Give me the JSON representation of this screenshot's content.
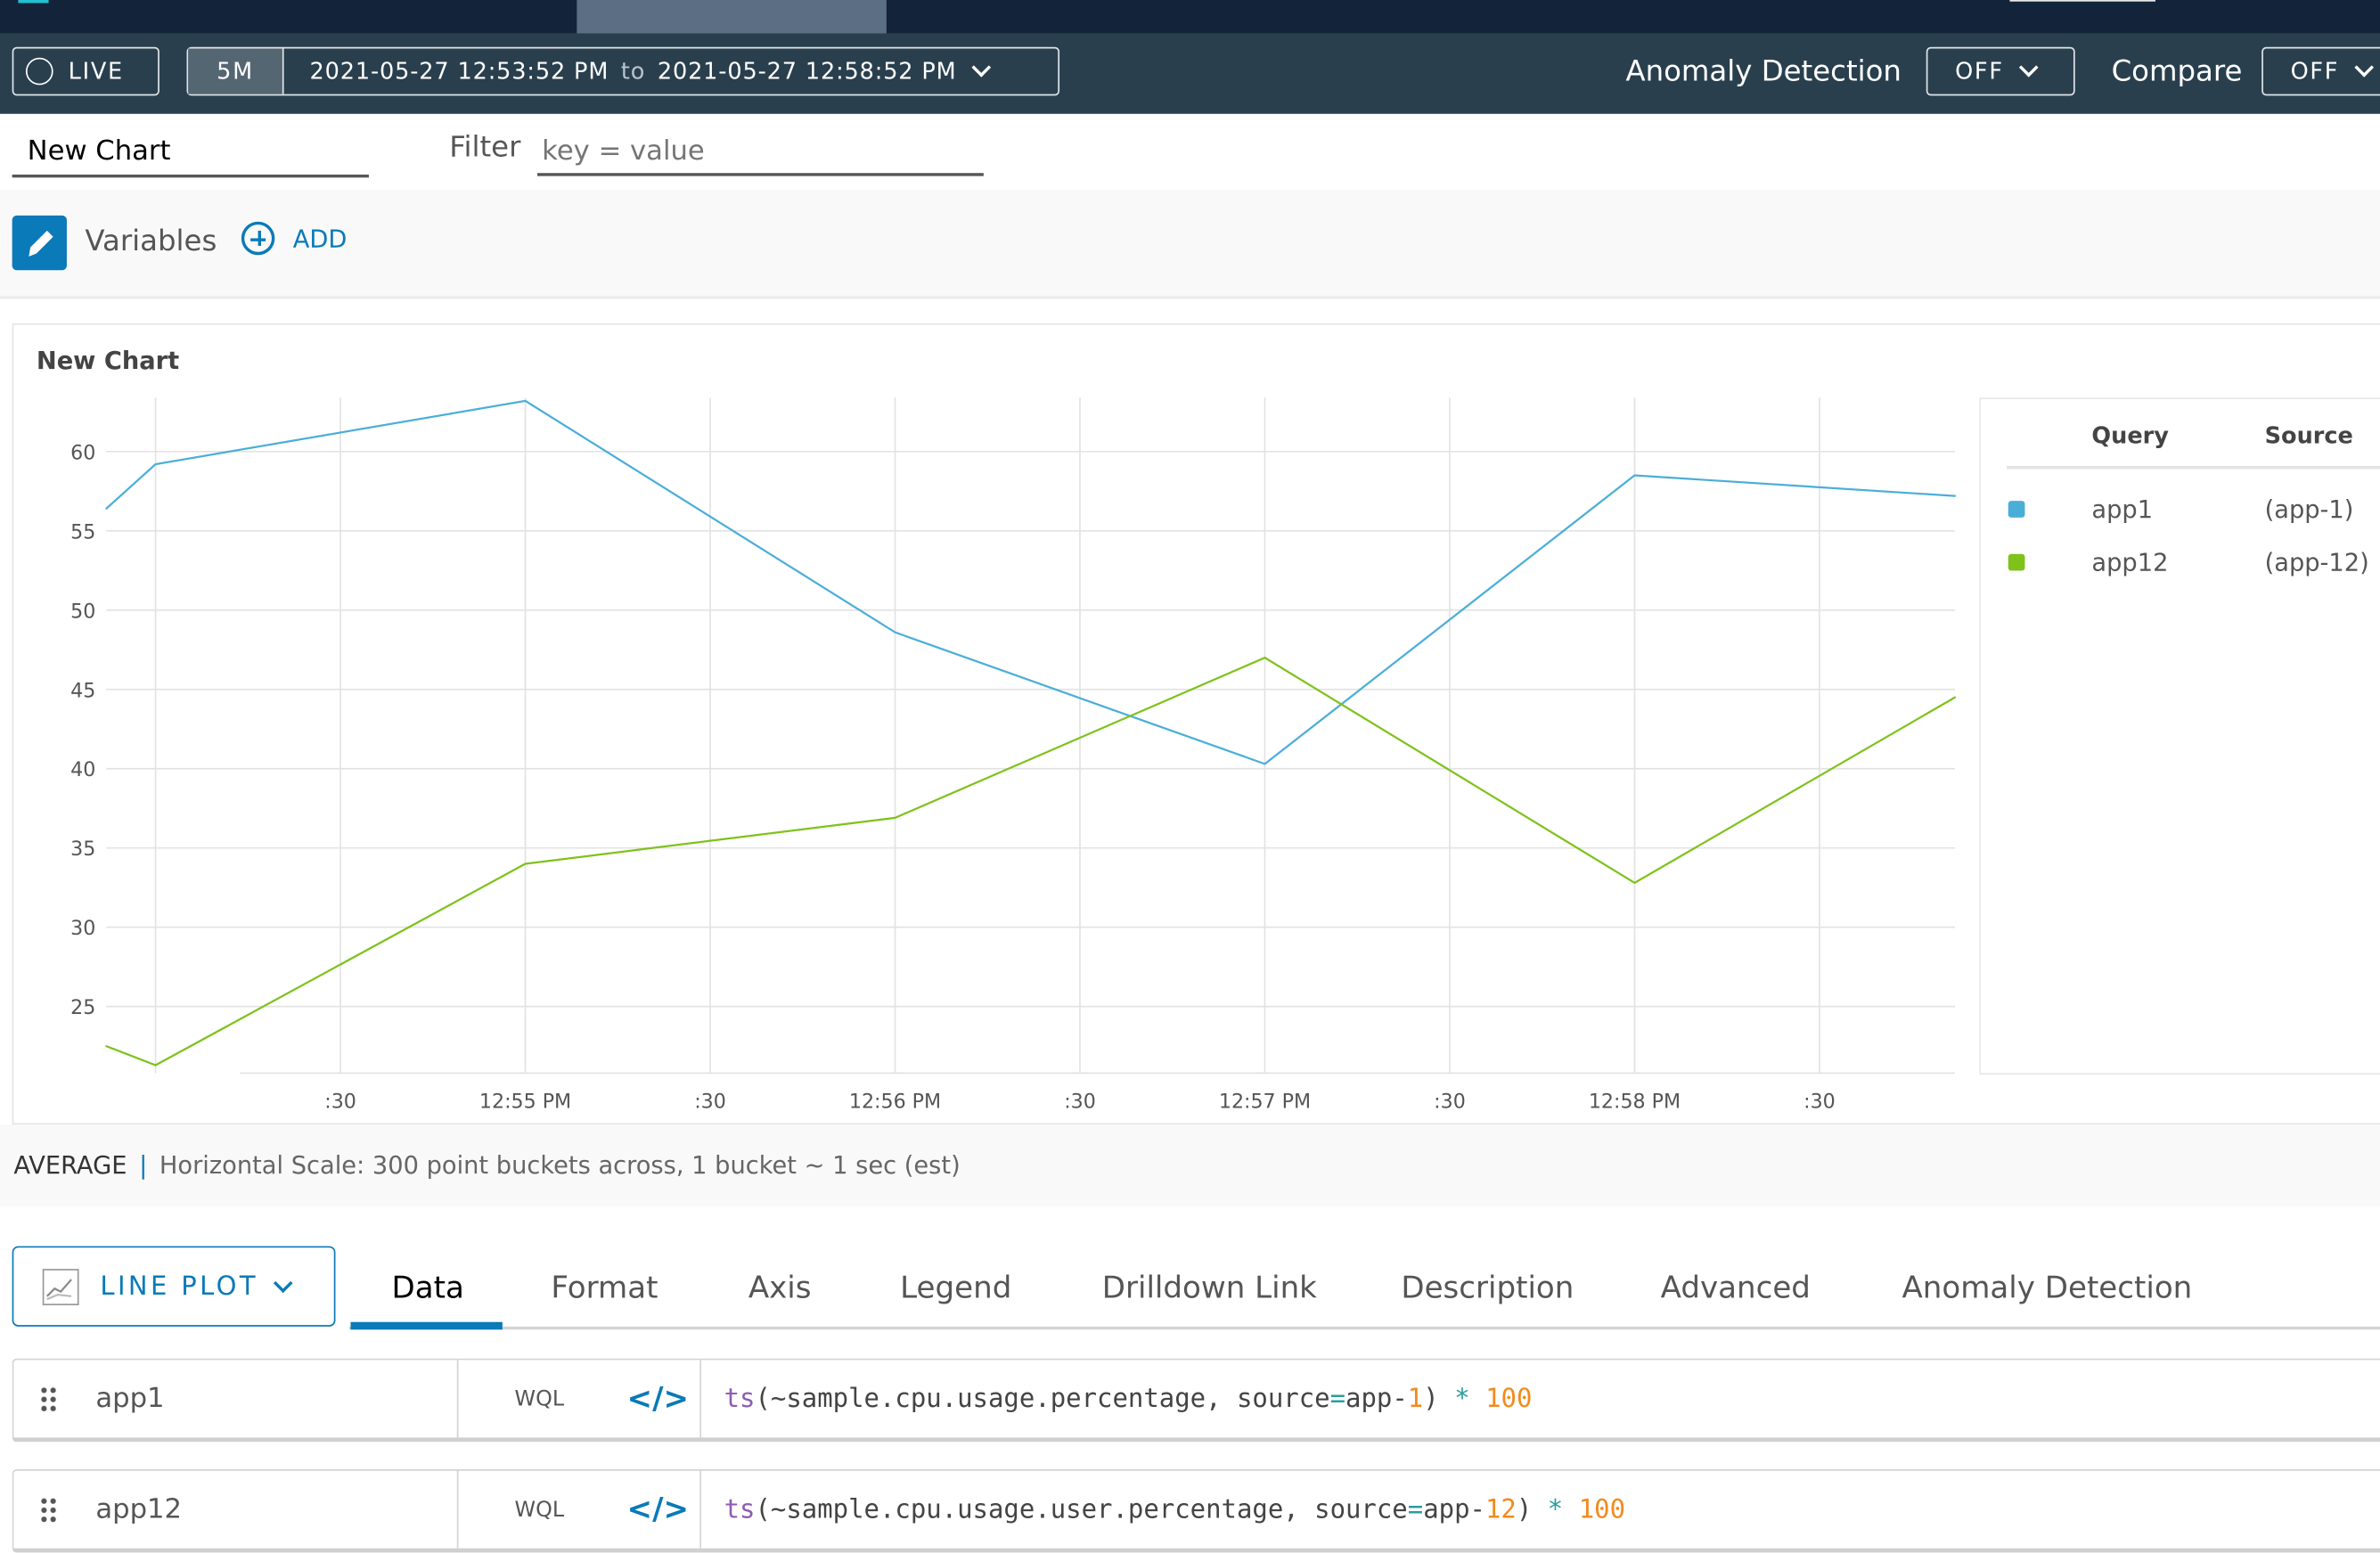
{
  "toolbar": {
    "live_label": "LIVE",
    "range_preset": "5M",
    "range_start": "2021-05-27 12:53:52 PM",
    "range_to": "to",
    "range_end": "2021-05-27 12:58:52 PM",
    "anomaly_label": "Anomaly Detection",
    "anomaly_value": "OFF",
    "compare_label": "Compare",
    "compare_value": "OFF"
  },
  "editor": {
    "chart_name": "New Chart",
    "filter_label": "Filter",
    "filter_placeholder": "key = value",
    "variables_label": "Variables",
    "add_label": "ADD"
  },
  "chart": {
    "title": "New Chart",
    "legend": {
      "headers": [
        "Query",
        "Source"
      ],
      "items": [
        {
          "query": "app1",
          "source": "(app-1)",
          "color": "#4aaed9"
        },
        {
          "query": "app12",
          "source": "(app-12)",
          "color": "#7ec21b"
        }
      ]
    }
  },
  "footer": {
    "mode": "AVERAGE",
    "scale_text": "Horizontal Scale: 300 point buckets across, 1 bucket ~ 1 sec (est)"
  },
  "chart_type_label": "LINE PLOT",
  "tabs": [
    "Data",
    "Format",
    "Axis",
    "Legend",
    "Drilldown Link",
    "Description",
    "Advanced",
    "Anomaly Detection"
  ],
  "active_tab": "Data",
  "queries": [
    {
      "name": "app1",
      "lang": "WQL",
      "fn": "ts",
      "metric": "(~sample.cpu.usage.percentage, source",
      "eq": "=",
      "src": "app-",
      "srcnum": "1",
      "close": ")",
      "op": "*",
      "mult": "100"
    },
    {
      "name": "app12",
      "lang": "WQL",
      "fn": "ts",
      "metric": "(~sample.cpu.usage.user.percentage, source",
      "eq": "=",
      "src": "app-",
      "srcnum": "12",
      "close": ")",
      "op": "*",
      "mult": "100"
    }
  ],
  "colors": {
    "accent": "#0a7ab8",
    "toolbar_bg": "#2a3f4e",
    "nav_bg": "#13243a"
  },
  "chart_data": {
    "type": "line",
    "title": "New Chart",
    "x": [
      "12:53:52",
      "12:54:00",
      "12:55:00",
      "12:56:00",
      "12:57:00",
      "12:58:00",
      "12:58:52"
    ],
    "series": [
      {
        "name": "app1",
        "color": "#4aaed9",
        "values": [
          56.4,
          59.2,
          63.2,
          48.6,
          40.3,
          58.5,
          57.2
        ]
      },
      {
        "name": "app12",
        "color": "#7ec21b",
        "values": [
          22.5,
          21.3,
          34.0,
          36.9,
          47.0,
          32.8,
          44.5
        ]
      }
    ],
    "xlim": [
      "12:53:52",
      "12:58:52"
    ],
    "ylim": [
      20.8,
      63.4
    ],
    "yticks": [
      25,
      30,
      35,
      40,
      45,
      50,
      55,
      60
    ],
    "xticks": [
      {
        "t": "12:54:30",
        "label": ":30"
      },
      {
        "t": "12:55:00",
        "label": "12:55 PM"
      },
      {
        "t": "12:55:30",
        "label": ":30"
      },
      {
        "t": "12:56:00",
        "label": "12:56 PM"
      },
      {
        "t": "12:56:30",
        "label": ":30"
      },
      {
        "t": "12:57:00",
        "label": "12:57 PM"
      },
      {
        "t": "12:57:30",
        "label": ":30"
      },
      {
        "t": "12:58:00",
        "label": "12:58 PM"
      },
      {
        "t": "12:58:30",
        "label": ":30"
      }
    ],
    "grid": true,
    "legend": "right"
  }
}
